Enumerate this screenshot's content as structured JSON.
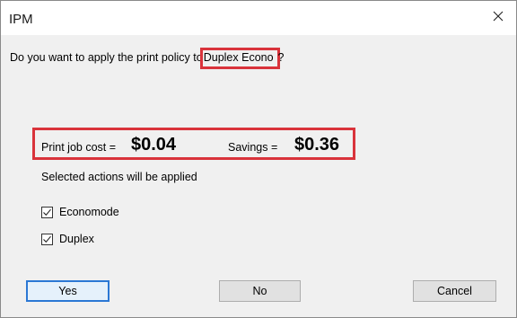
{
  "window": {
    "title": "IPM"
  },
  "dialog": {
    "question_prefix": "Do you want to apply the print policy to",
    "policy_name": "Duplex Econo",
    "question_suffix": "?",
    "print_job_cost_label": "Print job cost =",
    "print_job_cost_value": "$0.04",
    "savings_label": "Savings =",
    "savings_value": "$0.36",
    "applied_text": "Selected actions will be applied",
    "actions": [
      {
        "label": "Economode",
        "checked": true
      },
      {
        "label": "Duplex",
        "checked": true
      }
    ]
  },
  "buttons": {
    "yes": "Yes",
    "no": "No",
    "cancel": "Cancel"
  },
  "colors": {
    "highlight": "#d9333b",
    "default_button_border": "#2b78d4"
  }
}
